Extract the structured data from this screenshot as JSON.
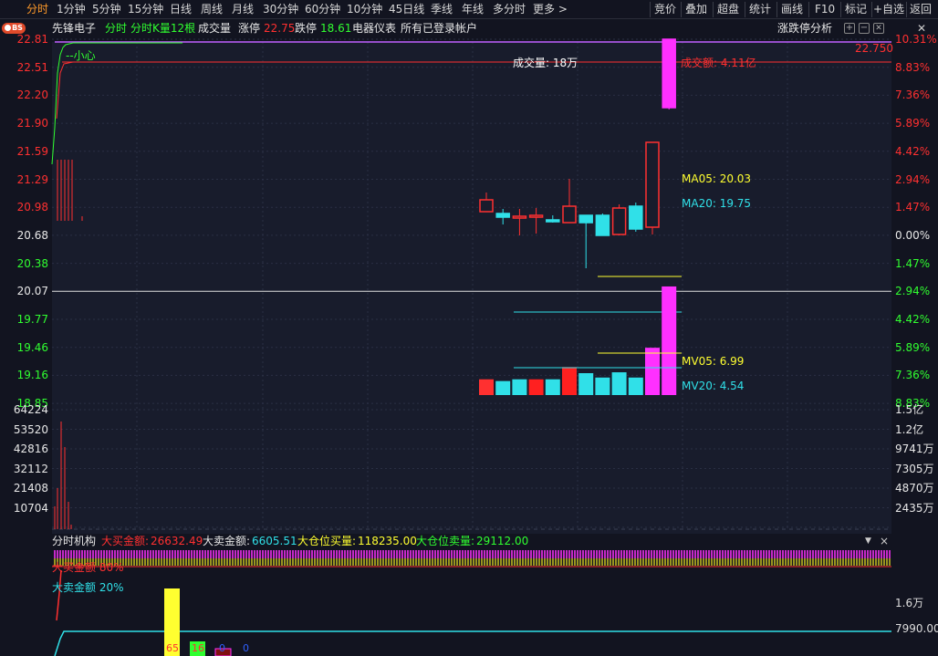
{
  "toolbar": {
    "periods": [
      "分时",
      "1分钟",
      "5分钟",
      "15分钟",
      "日线",
      "周线",
      "月线",
      "30分钟",
      "60分钟",
      "10分钟",
      "45日线",
      "季线",
      "年线",
      "多分时",
      "更多 >"
    ],
    "active_period": "分时",
    "right_buttons": [
      "竞价",
      "叠加",
      "超盘",
      "统计",
      "画线",
      "F10",
      "标记",
      "+自选",
      "返回"
    ]
  },
  "info": {
    "badge": "BS",
    "stock_name": "先锋电子",
    "mode_1": "分时",
    "mode_2": "分时K量12根",
    "mode_3": "成交量",
    "limit_up_label": "涨停",
    "limit_up_value": "22.75",
    "limit_down_label": "跌停",
    "limit_down_value": "18.61",
    "sector": "电器仪表",
    "account": "所有已登录帐户",
    "analysis_button": "涨跌停分析",
    "settings_icon": "settings-icon",
    "zoom_icon": "zoom-in-icon",
    "zoom_out_icon": "zoom-out-icon"
  },
  "price_axis": {
    "left": [
      "22.81",
      "22.51",
      "22.20",
      "21.90",
      "21.59",
      "21.29",
      "20.98",
      "20.68",
      "20.38",
      "20.07",
      "19.77",
      "19.46",
      "19.16",
      "18.85"
    ],
    "right": [
      "10.31%",
      "8.83%",
      "7.36%",
      "5.89%",
      "4.42%",
      "2.94%",
      "1.47%",
      "0.00%",
      "1.47%",
      "2.94%",
      "4.42%",
      "5.89%",
      "7.36%",
      "8.83%"
    ],
    "limit_price_tag": "22.750"
  },
  "volume_axis": {
    "left": [
      "64224",
      "53520",
      "42816",
      "32112",
      "21408",
      "10704"
    ],
    "right": [
      "1.5亿",
      "1.2亿",
      "9741万",
      "7305万",
      "4870万",
      "2435万"
    ]
  },
  "annotations": {
    "caution": "--小心",
    "volume_label": "成交量: 18万",
    "amount_label": "成交额: 4.11亿",
    "ma05": "MA05: 20.03",
    "ma20": "MA20: 19.75",
    "mv05": "MV05: 6.99",
    "mv20": "MV20: 4.54"
  },
  "institution_bar": {
    "title": "分时机构",
    "big_buy_label": "大买金额:",
    "big_buy_value": "26632.49",
    "big_sell_label": "大卖金额:",
    "big_sell_value": "6605.51",
    "pos_buy_label": "大仓位买量:",
    "pos_buy_value": "118235.00",
    "pos_sell_label": "大仓位卖量:",
    "pos_sell_value": "29112.00",
    "big_buy_pct_label": "大买金额",
    "big_buy_pct": "80%",
    "big_sell_pct_label": "大卖金额",
    "big_sell_pct": "20%",
    "axis_top": "1.6万",
    "axis_bottom": "7990.00",
    "bar_labels": [
      "65",
      "16",
      "0",
      "0"
    ]
  },
  "colors": {
    "up": "#ff3030",
    "down": "#30e0e8",
    "accent": "#ff9a2a",
    "magenta": "#ff30ff",
    "yellow": "#ffff30",
    "green": "#30ff30"
  },
  "chart_data": {
    "type": "candlestick",
    "ma05": 20.03,
    "ma20": 19.75,
    "candles": [
      {
        "open": 20.92,
        "close": 21.05,
        "high": 21.13,
        "low": 20.92
      },
      {
        "open": 20.9,
        "close": 20.86,
        "high": 20.95,
        "low": 20.78
      },
      {
        "open": 20.87,
        "close": 20.87,
        "high": 20.95,
        "low": 20.66
      },
      {
        "open": 20.87,
        "close": 20.88,
        "high": 20.96,
        "low": 20.68
      },
      {
        "open": 20.83,
        "close": 20.82,
        "high": 20.88,
        "low": 20.8
      },
      {
        "open": 20.8,
        "close": 20.98,
        "high": 21.28,
        "low": 20.8
      },
      {
        "open": 20.88,
        "close": 20.8,
        "high": 20.88,
        "low": 20.3
      },
      {
        "open": 20.88,
        "close": 20.66,
        "high": 20.9,
        "low": 20.66
      },
      {
        "open": 20.67,
        "close": 20.96,
        "high": 21.0,
        "low": 20.66
      },
      {
        "open": 20.98,
        "close": 20.73,
        "high": 21.02,
        "low": 20.7
      },
      {
        "open": 20.75,
        "close": 21.68,
        "high": 21.68,
        "low": 20.67
      },
      {
        "open": 22.06,
        "close": 22.81,
        "high": 22.81,
        "low": 22.04
      }
    ],
    "volumes": [
      1.8,
      1.6,
      1.8,
      1.8,
      1.8,
      3.2,
      2.5,
      2.0,
      2.6,
      2.0,
      5.4,
      12.4
    ],
    "mv05": 6.99,
    "mv20": 4.54
  }
}
